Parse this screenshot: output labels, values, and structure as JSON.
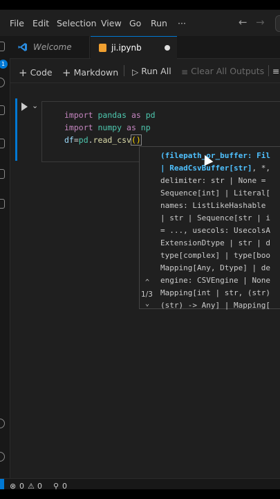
{
  "menu": {
    "items": [
      "File",
      "Edit",
      "Selection",
      "View",
      "Go",
      "Run",
      "···"
    ]
  },
  "nav": {
    "back": "←",
    "forward": "→"
  },
  "tabs": [
    {
      "label": "Welcome",
      "icon": "vscode-logo-icon"
    },
    {
      "label": "ji.ipynb",
      "icon": "notebook-icon",
      "dirty": true
    }
  ],
  "activity_badge": "1",
  "toolbar": {
    "code": "Code",
    "markdown": "Markdown",
    "run_all": "Run All",
    "clear_outputs": "Clear All Outputs"
  },
  "cell": {
    "lines": [
      [
        {
          "t": "import",
          "c": "kw"
        },
        {
          "t": " pandas ",
          "c": "id"
        },
        {
          "t": "as",
          "c": "kw"
        },
        {
          "t": " pd",
          "c": "id"
        }
      ],
      [
        {
          "t": "import",
          "c": "kw"
        },
        {
          "t": " numpy ",
          "c": "id"
        },
        {
          "t": "as",
          "c": "kw"
        },
        {
          "t": " np",
          "c": "id"
        }
      ],
      [
        {
          "t": "df",
          "c": "var"
        },
        {
          "t": "=",
          "c": ""
        },
        {
          "t": "pd",
          "c": "id"
        },
        {
          "t": ".",
          "c": ""
        },
        {
          "t": "read_csv",
          "c": "fn"
        },
        {
          "t": "()",
          "c": "paren"
        }
      ]
    ]
  },
  "signature": {
    "counter": "1/3",
    "up": "^",
    "down": "⌄",
    "lines": [
      [
        {
          "t": "(filepath_or_buffer: Fil",
          "c": "hl"
        }
      ],
      [
        {
          "t": "| ",
          "c": "hl"
        },
        {
          "t": "ReadCsvBuffer[str]",
          "c": "hl"
        },
        {
          "t": ", *,",
          "c": ""
        }
      ],
      [
        {
          "t": "delimiter: str | None = ",
          "c": ""
        }
      ],
      [
        {
          "t": "Sequence[int] | Literal[",
          "c": ""
        }
      ],
      [
        {
          "t": "names: ListLikeHashable ",
          "c": ""
        }
      ],
      [
        {
          "t": "| str | Sequence[str | i",
          "c": ""
        }
      ],
      [
        {
          "t": "= ..., usecols: UsecolsA",
          "c": ""
        }
      ],
      [
        {
          "t": "ExtensionDtype | str | d",
          "c": ""
        }
      ],
      [
        {
          "t": "type[complex] | type[boo",
          "c": ""
        }
      ],
      [
        {
          "t": "Mapping[Any, Dtype] | de",
          "c": ""
        }
      ],
      [
        {
          "t": "engine: CSVEngine | None",
          "c": ""
        }
      ],
      [
        {
          "t": "Mapping[int | str, (str)",
          "c": ""
        }
      ],
      [
        {
          "t": "(str) -> Any] | Mapping[",
          "c": ""
        }
      ]
    ]
  },
  "status": {
    "errors": "0",
    "warnings": "0",
    "ports": "0"
  }
}
